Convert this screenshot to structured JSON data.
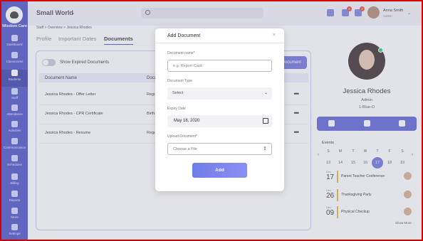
{
  "app": {
    "logo_text": "Wisdom Care",
    "school_name": "Small World"
  },
  "sidebar": {
    "items": [
      {
        "label": "Dashboard",
        "icon": "dashboard-icon"
      },
      {
        "label": "Classrooms",
        "icon": "classrooms-icon"
      },
      {
        "label": "Students",
        "icon": "students-icon",
        "active": true
      },
      {
        "label": "Staff",
        "icon": "staff-icon"
      },
      {
        "label": "Attendance",
        "icon": "attendance-icon"
      },
      {
        "label": "Activities",
        "icon": "activities-icon"
      },
      {
        "label": "Communication",
        "icon": "communication-icon"
      },
      {
        "label": "Schedules",
        "icon": "schedules-icon"
      },
      {
        "label": "Billing",
        "icon": "billing-icon"
      },
      {
        "label": "Reports",
        "icon": "reports-icon"
      },
      {
        "label": "More",
        "icon": "more-icon"
      },
      {
        "label": "Settings",
        "icon": "settings-icon"
      }
    ]
  },
  "header": {
    "search_placeholder": "",
    "badges": {
      "messages": "5",
      "notifications": "2"
    },
    "user_name": "Anna Smith",
    "user_role": "Admin"
  },
  "breadcrumb": {
    "items": [
      "Staff",
      "Overview",
      "Jessica Rhodes"
    ]
  },
  "tabs": [
    {
      "label": "Profile"
    },
    {
      "label": "Important Dates"
    },
    {
      "label": "Documents",
      "active": true
    }
  ],
  "documents": {
    "toggle_label": "Show Expired Documents",
    "add_button_label": "Add Document",
    "columns": [
      "Document Name",
      "Document Type"
    ],
    "rows": [
      {
        "name": "Jessica Rhodes - Offer Letter",
        "type": "Regular"
      },
      {
        "name": "Jessica Rhodes - CPR Certificate",
        "type": "Birth Certificate"
      },
      {
        "name": "Jessica Rhodes - Resume",
        "type": "Regular"
      }
    ],
    "row_menu": "•••"
  },
  "profile": {
    "name": "Jessica Rhodes",
    "role": "Admin",
    "class": "1-Blue-O"
  },
  "events": {
    "title": "Events",
    "days_of_week": [
      "S",
      "M",
      "T",
      "W",
      "T",
      "F",
      "S"
    ],
    "days": [
      "13",
      "14",
      "15",
      "16",
      "17",
      "18",
      "19"
    ],
    "selected_day": "17",
    "list": [
      {
        "month": "Dec",
        "day": "17",
        "name": "Parent Teacher Conference"
      },
      {
        "month": "Dec",
        "day": "26",
        "name": "Thanksgiving Party"
      },
      {
        "month": "Dec",
        "day": "09",
        "name": "Physical Checkup"
      }
    ],
    "show_more": "Show More"
  },
  "modal": {
    "title": "Add Document",
    "close_symbol": "×",
    "name_label": "Document name*",
    "name_placeholder": "e.g. Report Card",
    "type_label": "Document Type",
    "type_value": "Select",
    "expiry_label": "Expiry Date",
    "expiry_value": "May 18, 2020",
    "upload_label": "Upload Document*",
    "upload_value": "Choose a File",
    "add_button": "Add"
  },
  "colors": {
    "sidebar": "#4b54c6",
    "accent": "#6c74e0",
    "online": "#2ecc71"
  }
}
